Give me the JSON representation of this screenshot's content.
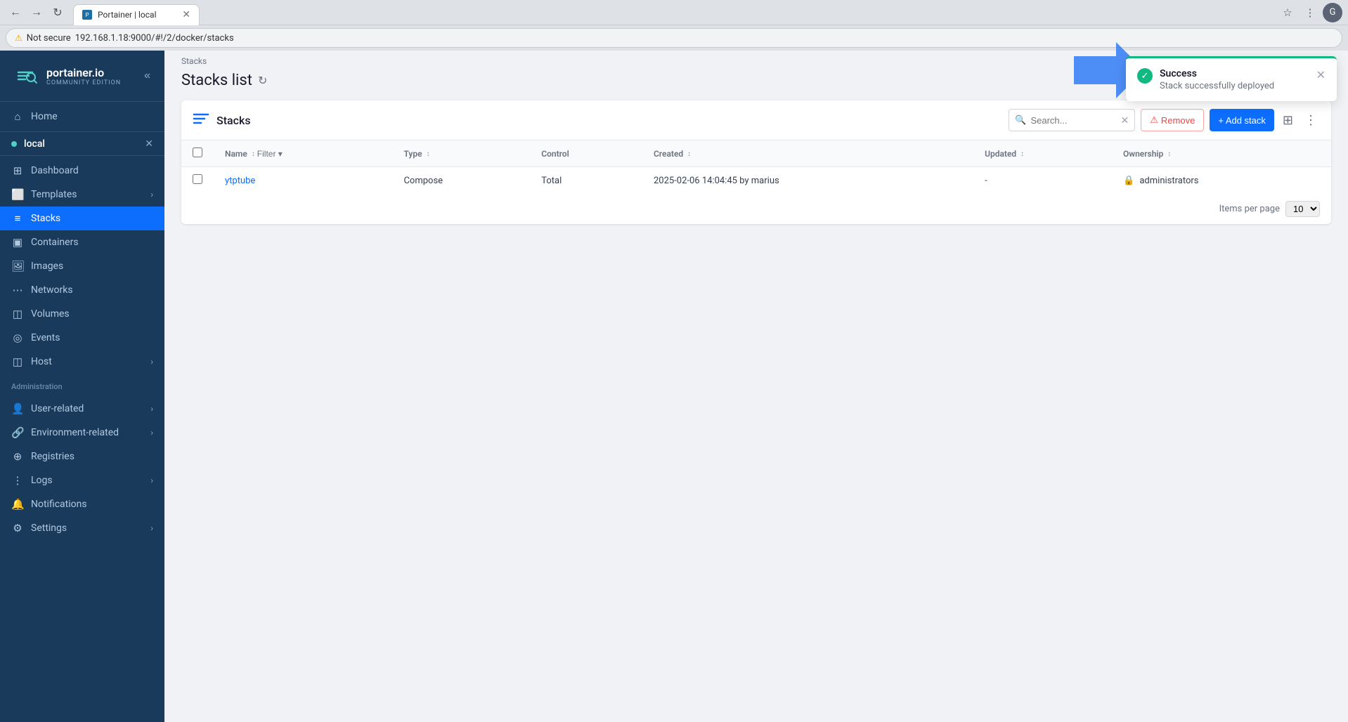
{
  "browser": {
    "tab_title": "Portainer | local",
    "tab_favicon": "P",
    "address": "192.168.1.18:9000/#!/2/docker/stacks",
    "security_label": "Not secure"
  },
  "sidebar": {
    "logo_title": "portainer.io",
    "logo_subtitle": "COMMUNITY EDITION",
    "collapse_label": "«",
    "home_label": "Home",
    "templates_label": "Templates",
    "stacks_label": "Stacks",
    "containers_label": "Containers",
    "images_label": "Images",
    "networks_label": "Networks",
    "volumes_label": "Volumes",
    "events_label": "Events",
    "host_label": "Host",
    "environment_name": "local",
    "admin_section_label": "Administration",
    "user_related_label": "User-related",
    "environment_related_label": "Environment-related",
    "registries_label": "Registries",
    "logs_label": "Logs",
    "notifications_label": "Notifications",
    "settings_label": "Settings"
  },
  "main": {
    "breadcrumb": "Stacks",
    "page_title": "Stacks list",
    "panel_title": "Stacks",
    "search_placeholder": "Search...",
    "remove_label": "Remove",
    "add_stack_label": "+ Add stack",
    "table": {
      "columns": [
        "Name",
        "Type",
        "Control",
        "Created",
        "Updated",
        "Ownership"
      ],
      "filter_label": "Filter",
      "rows": [
        {
          "name": "ytptube",
          "type": "Compose",
          "control": "Total",
          "created": "2025-02-06 14:04:45 by marius",
          "updated": "-",
          "ownership": "administrators"
        }
      ]
    },
    "items_per_page_label": "Items per page",
    "items_per_page_value": "10"
  },
  "notification": {
    "title": "Success",
    "message": "Stack successfully deployed"
  }
}
